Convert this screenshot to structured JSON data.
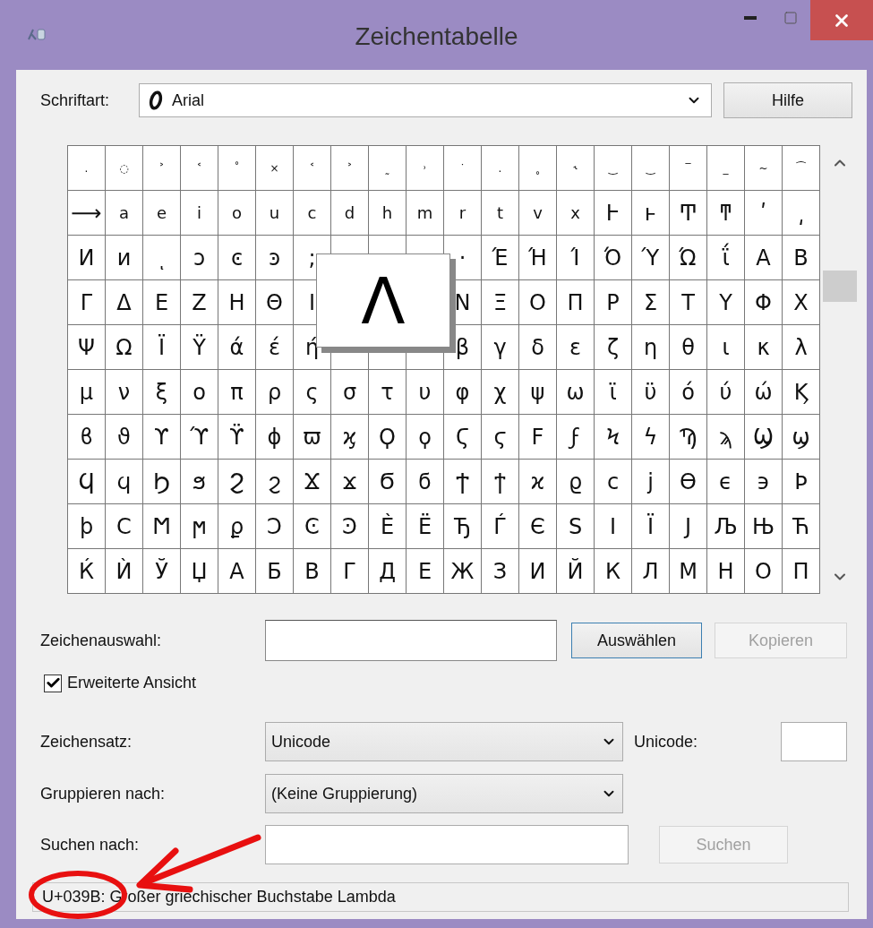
{
  "window": {
    "title": "Zeichentabelle"
  },
  "font": {
    "label": "Schriftart:",
    "value": "Arial"
  },
  "help_button": "Hilfe",
  "grid": {
    "rows": [
      [
        ".",
        "◌",
        "˃",
        "˂",
        "˚",
        "×",
        "˂",
        "˃",
        "˷",
        "˒",
        "˙",
        ".",
        "˳",
        "˞",
        "‿",
        "‿",
        "‾",
        "_",
        "~",
        "⁀"
      ],
      [
        "⟶",
        "a",
        "e",
        "i",
        "o",
        "u",
        "c",
        "d",
        "h",
        "m",
        "r",
        "t",
        "v",
        "x",
        "Ͱ",
        "ͱ",
        "Ͳ",
        "ͳ",
        "ʹ",
        "͵"
      ],
      [
        "Ͷ",
        "ͷ",
        "ͺ",
        "ͻ",
        "ͼ",
        "ͽ",
        ";",
        null,
        null,
        null,
        "·",
        "Έ",
        "Ή",
        "Ί",
        "Ό",
        "Ύ",
        "Ώ",
        "ΐ",
        "Α",
        "Β"
      ],
      [
        "Γ",
        "Δ",
        "Ε",
        "Ζ",
        "Η",
        "Θ",
        "Ι",
        null,
        null,
        null,
        "Ν",
        "Ξ",
        "Ο",
        "Π",
        "Ρ",
        "Σ",
        "Τ",
        "Υ",
        "Φ",
        "Χ"
      ],
      [
        "Ψ",
        "Ω",
        "Ϊ",
        "Ϋ",
        "ά",
        "έ",
        "ή",
        null,
        null,
        null,
        "β",
        "γ",
        "δ",
        "ε",
        "ζ",
        "η",
        "θ",
        "ι",
        "κ",
        "λ"
      ],
      [
        "μ",
        "ν",
        "ξ",
        "ο",
        "π",
        "ρ",
        "ς",
        "σ",
        "τ",
        "υ",
        "φ",
        "χ",
        "ψ",
        "ω",
        "ϊ",
        "ϋ",
        "ό",
        "ύ",
        "ώ",
        "Ϗ"
      ],
      [
        "ϐ",
        "ϑ",
        "ϒ",
        "ϓ",
        "ϔ",
        "ϕ",
        "ϖ",
        "ϗ",
        "Ϙ",
        "ϙ",
        "Ϛ",
        "ϛ",
        "Ϝ",
        "ϝ",
        "Ϟ",
        "ϟ",
        "Ϡ",
        "ϡ",
        "Ϣ",
        "ϣ"
      ],
      [
        "Ϥ",
        "ϥ",
        "Ϧ",
        "ϧ",
        "Ϩ",
        "ϩ",
        "Ϫ",
        "ϫ",
        "Ϭ",
        "ϭ",
        "Ϯ",
        "ϯ",
        "ϰ",
        "ϱ",
        "ϲ",
        "ϳ",
        "ϴ",
        "ϵ",
        "϶",
        "Ϸ"
      ],
      [
        "ϸ",
        "Ϲ",
        "Ϻ",
        "ϻ",
        "ϼ",
        "Ͻ",
        "Ͼ",
        "Ͽ",
        "Ѐ",
        "Ё",
        "Ђ",
        "Ѓ",
        "Є",
        "Ѕ",
        "І",
        "Ї",
        "Ј",
        "Љ",
        "Њ",
        "Ћ"
      ],
      [
        "Ќ",
        "Ѝ",
        "Ў",
        "Џ",
        "А",
        "Б",
        "В",
        "Г",
        "Д",
        "Е",
        "Ж",
        "З",
        "И",
        "Й",
        "К",
        "Л",
        "М",
        "Н",
        "О",
        "П"
      ]
    ],
    "preview": "Λ"
  },
  "selection": {
    "label": "Zeichenauswahl:",
    "select_button": "Auswählen",
    "copy_button": {
      "label": "Kopieren",
      "disabled": true
    }
  },
  "advanced_view": {
    "label": "Erweiterte Ansicht",
    "checked": true
  },
  "charset": {
    "label": "Zeichensatz:",
    "value": "Unicode"
  },
  "unicode": {
    "label": "Unicode:"
  },
  "group_by": {
    "label": "Gruppieren nach:",
    "value": "(Keine Gruppierung)"
  },
  "search": {
    "label": "Suchen nach:",
    "button": {
      "label": "Suchen",
      "disabled": true
    }
  },
  "status_bar": "U+039B: Großer griechischer Buchstabe Lambda"
}
